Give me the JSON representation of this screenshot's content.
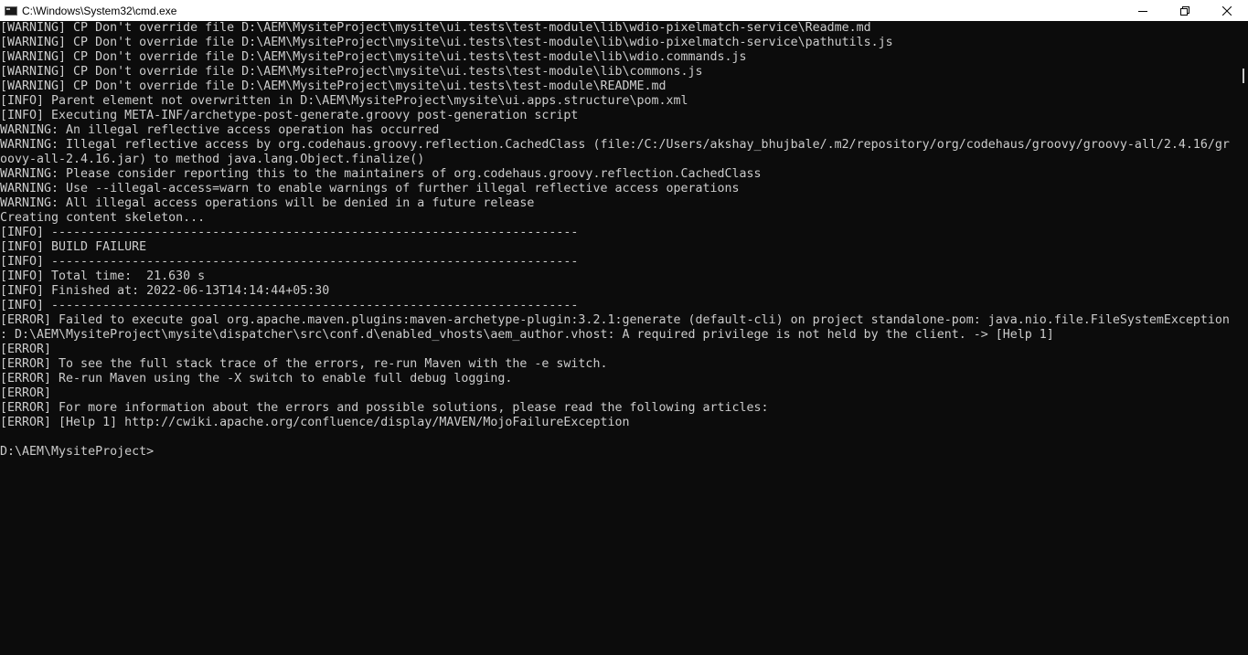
{
  "window": {
    "title": "C:\\Windows\\System32\\cmd.exe"
  },
  "icons": {
    "app": "cmd-icon",
    "minimize": "minimize-icon",
    "maximize": "restore-icon",
    "close": "close-icon"
  },
  "colors": {
    "console_background": "#0c0c0c",
    "console_text": "#cccccc",
    "titlebar_background": "#ffffff"
  },
  "console": {
    "lines": [
      "[WARNING] CP Don't override file D:\\AEM\\MysiteProject\\mysite\\ui.tests\\test-module\\lib\\wdio-pixelmatch-service\\Readme.md",
      "[WARNING] CP Don't override file D:\\AEM\\MysiteProject\\mysite\\ui.tests\\test-module\\lib\\wdio-pixelmatch-service\\pathutils.js",
      "[WARNING] CP Don't override file D:\\AEM\\MysiteProject\\mysite\\ui.tests\\test-module\\lib\\wdio.commands.js",
      "[WARNING] CP Don't override file D:\\AEM\\MysiteProject\\mysite\\ui.tests\\test-module\\lib\\commons.js",
      "[WARNING] CP Don't override file D:\\AEM\\MysiteProject\\mysite\\ui.tests\\test-module\\README.md",
      "[INFO] Parent element not overwritten in D:\\AEM\\MysiteProject\\mysite\\ui.apps.structure\\pom.xml",
      "[INFO] Executing META-INF/archetype-post-generate.groovy post-generation script",
      "WARNING: An illegal reflective access operation has occurred",
      "WARNING: Illegal reflective access by org.codehaus.groovy.reflection.CachedClass (file:/C:/Users/akshay_bhujbale/.m2/repository/org/codehaus/groovy/groovy-all/2.4.16/gr",
      "oovy-all-2.4.16.jar) to method java.lang.Object.finalize()",
      "WARNING: Please consider reporting this to the maintainers of org.codehaus.groovy.reflection.CachedClass",
      "WARNING: Use --illegal-access=warn to enable warnings of further illegal reflective access operations",
      "WARNING: All illegal access operations will be denied in a future release",
      "Creating content skeleton...",
      "[INFO] ------------------------------------------------------------------------",
      "[INFO] BUILD FAILURE",
      "[INFO] ------------------------------------------------------------------------",
      "[INFO] Total time:  21.630 s",
      "[INFO] Finished at: 2022-06-13T14:14:44+05:30",
      "[INFO] ------------------------------------------------------------------------",
      "[ERROR] Failed to execute goal org.apache.maven.plugins:maven-archetype-plugin:3.2.1:generate (default-cli) on project standalone-pom: java.nio.file.FileSystemException",
      ": D:\\AEM\\MysiteProject\\mysite\\dispatcher\\src\\conf.d\\enabled_vhosts\\aem_author.vhost: A required privilege is not held by the client. -> [Help 1]",
      "[ERROR]",
      "[ERROR] To see the full stack trace of the errors, re-run Maven with the -e switch.",
      "[ERROR] Re-run Maven using the -X switch to enable full debug logging.",
      "[ERROR]",
      "[ERROR] For more information about the errors and possible solutions, please read the following articles:",
      "[ERROR] [Help 1] http://cwiki.apache.org/confluence/display/MAVEN/MojoFailureException",
      "",
      "D:\\AEM\\MysiteProject>"
    ]
  }
}
